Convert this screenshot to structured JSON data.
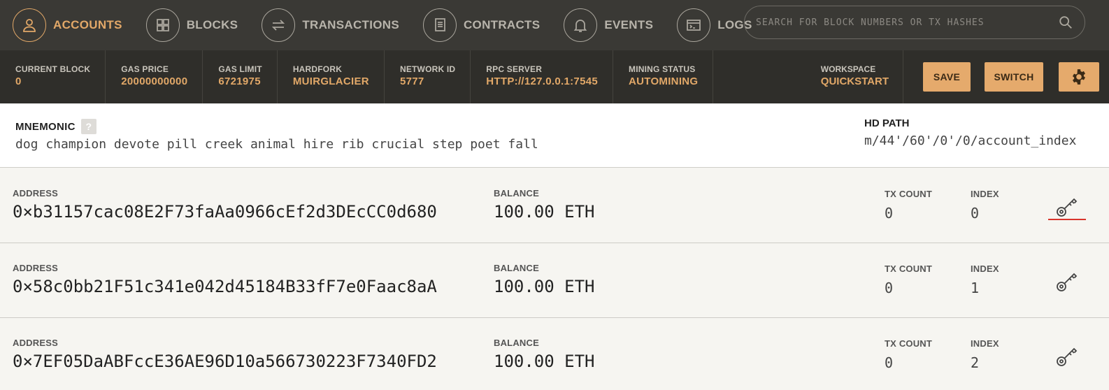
{
  "nav": {
    "items": [
      {
        "label": "ACCOUNTS",
        "icon": "user-icon",
        "active": true
      },
      {
        "label": "BLOCKS",
        "icon": "blocks-grid-icon",
        "active": false
      },
      {
        "label": "TRANSACTIONS",
        "icon": "transfer-arrows-icon",
        "active": false
      },
      {
        "label": "CONTRACTS",
        "icon": "document-icon",
        "active": false
      },
      {
        "label": "EVENTS",
        "icon": "bell-icon",
        "active": false
      },
      {
        "label": "LOGS",
        "icon": "terminal-icon",
        "active": false
      }
    ],
    "search_placeholder": "SEARCH FOR BLOCK NUMBERS OR TX HASHES"
  },
  "status": {
    "current_block": {
      "label": "CURRENT BLOCK",
      "value": "0"
    },
    "gas_price": {
      "label": "GAS PRICE",
      "value": "20000000000"
    },
    "gas_limit": {
      "label": "GAS LIMIT",
      "value": "6721975"
    },
    "hardfork": {
      "label": "HARDFORK",
      "value": "MUIRGLACIER"
    },
    "network_id": {
      "label": "NETWORK ID",
      "value": "5777"
    },
    "rpc_server": {
      "label": "RPC SERVER",
      "value": "HTTP://127.0.0.1:7545"
    },
    "mining_status": {
      "label": "MINING STATUS",
      "value": "AUTOMINING"
    },
    "workspace": {
      "label": "WORKSPACE",
      "value": "QUICKSTART"
    },
    "save_label": "SAVE",
    "switch_label": "SWITCH"
  },
  "mnemonic": {
    "title": "MNEMONIC",
    "help": "?",
    "words": "dog champion devote pill creek animal hire rib crucial step poet fall",
    "hd_path_title": "HD PATH",
    "hd_path": "m/44'/60'/0'/0/account_index"
  },
  "accounts": [
    {
      "address_label": "ADDRESS",
      "address": "0×b31157cac08E2F73faAa0966cEf2d3DEcCC0d680",
      "balance_label": "BALANCE",
      "balance": "100.00 ETH",
      "tx_label": "TX COUNT",
      "tx_count": "0",
      "index_label": "INDEX",
      "index": "0"
    },
    {
      "address_label": "ADDRESS",
      "address": "0×58c0bb21F51c341e042d45184B33fF7e0Faac8aA",
      "balance_label": "BALANCE",
      "balance": "100.00 ETH",
      "tx_label": "TX COUNT",
      "tx_count": "0",
      "index_label": "INDEX",
      "index": "1"
    },
    {
      "address_label": "ADDRESS",
      "address": "0×7EF05DaABFccE36AE96D10a566730223F7340FD2",
      "balance_label": "BALANCE",
      "balance": "100.00 ETH",
      "tx_label": "TX COUNT",
      "tx_count": "0",
      "index_label": "INDEX",
      "index": "2"
    }
  ],
  "colors": {
    "accent": "#e2a868",
    "nav_bg": "#3a3935",
    "status_bg": "#2f2e2a",
    "highlight_underline": "#d9342b"
  }
}
